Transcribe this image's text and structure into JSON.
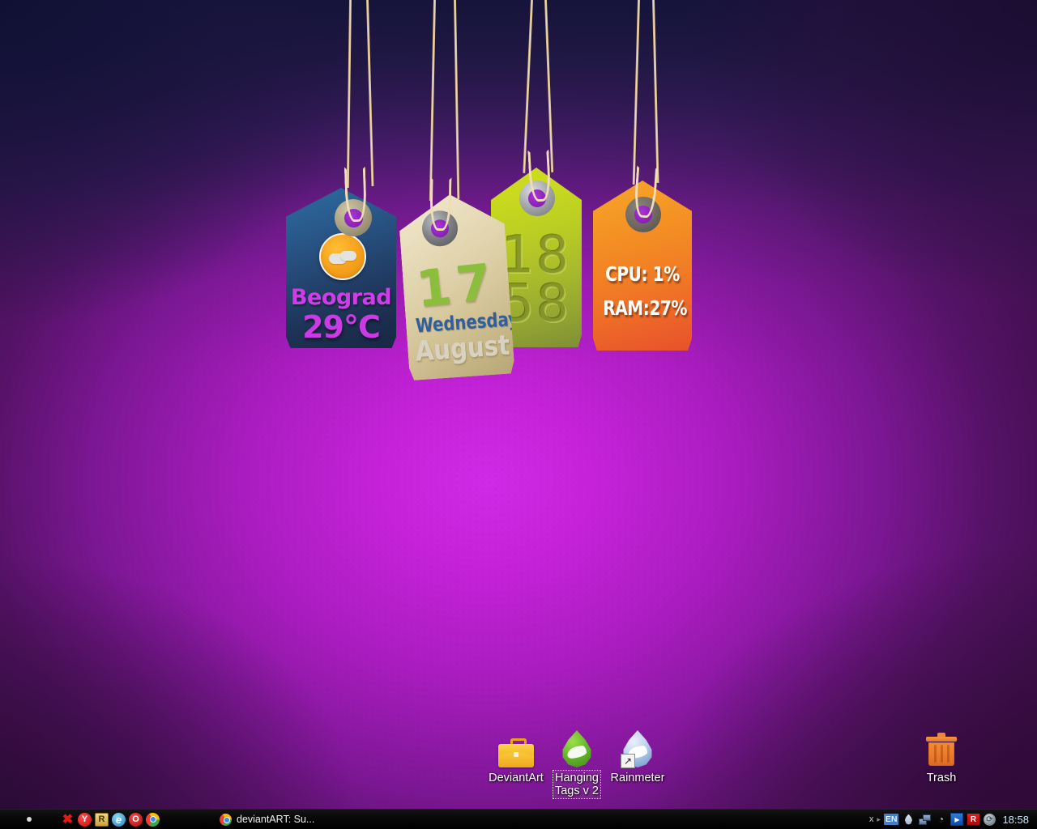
{
  "wallpaper": {
    "theme_name": "Hanging Tags v 2",
    "colors": {
      "center": "#c422d8",
      "top_left": "#141438",
      "bottom_right": "#3a0d46",
      "string": "#e8cfa6"
    }
  },
  "tags": {
    "weather": {
      "name": "weather-tag",
      "city": "Beograd",
      "temperature": "29°C",
      "condition_icon": "sun-behind-cloud-icon",
      "color": "#27507f"
    },
    "date": {
      "name": "date-tag",
      "day": "17",
      "weekday": "Wednesday",
      "month": "August",
      "color": "#e0d3ac"
    },
    "clock": {
      "name": "clock-tag",
      "hours": "18",
      "minutes": "58",
      "color": "#bccd22"
    },
    "system": {
      "name": "system-tag",
      "cpu": "CPU: 1%",
      "ram": "RAM:27%",
      "color": "#f28a26"
    }
  },
  "desktop_icons": [
    {
      "label": "DeviantArt",
      "icon": "briefcase-icon",
      "selected": false
    },
    {
      "label": "Hanging Tags v 2",
      "label_line1": "Hanging",
      "label_line2": "Tags v 2",
      "icon": "green-raindrop-icon",
      "selected": true
    },
    {
      "label": "Rainmeter",
      "icon": "blue-raindrop-shortcut-icon",
      "selected": false
    },
    {
      "label": "Trash",
      "icon": "trash-can-icon",
      "selected": false
    }
  ],
  "taskbar": {
    "quick_launch": [
      {
        "name": "show-desktop-dot",
        "glyph": ""
      },
      {
        "name": "close-icon",
        "glyph": "✖"
      },
      {
        "name": "yandex-icon",
        "glyph": "Y"
      },
      {
        "name": "rainmeter-r-icon",
        "glyph": "R"
      },
      {
        "name": "internet-explorer-icon",
        "glyph": "e"
      },
      {
        "name": "opera-icon",
        "glyph": "O"
      },
      {
        "name": "chrome-icon",
        "glyph": ""
      }
    ],
    "windows": [
      {
        "title": "deviantART: Su...",
        "icon": "chrome-icon"
      }
    ],
    "tray": {
      "close_glyph": "x",
      "overflow_arrow": "▸",
      "language": "EN",
      "icons": [
        {
          "name": "rainmeter-tray-icon"
        },
        {
          "name": "network-icon"
        },
        {
          "name": "volume-icon",
          "glyph": "◔"
        },
        {
          "name": "media-player-icon",
          "glyph": "▶"
        },
        {
          "name": "avira-icon",
          "glyph": "R"
        },
        {
          "name": "sync-icon",
          "glyph": "⟳"
        }
      ],
      "clock": "18:58"
    }
  }
}
